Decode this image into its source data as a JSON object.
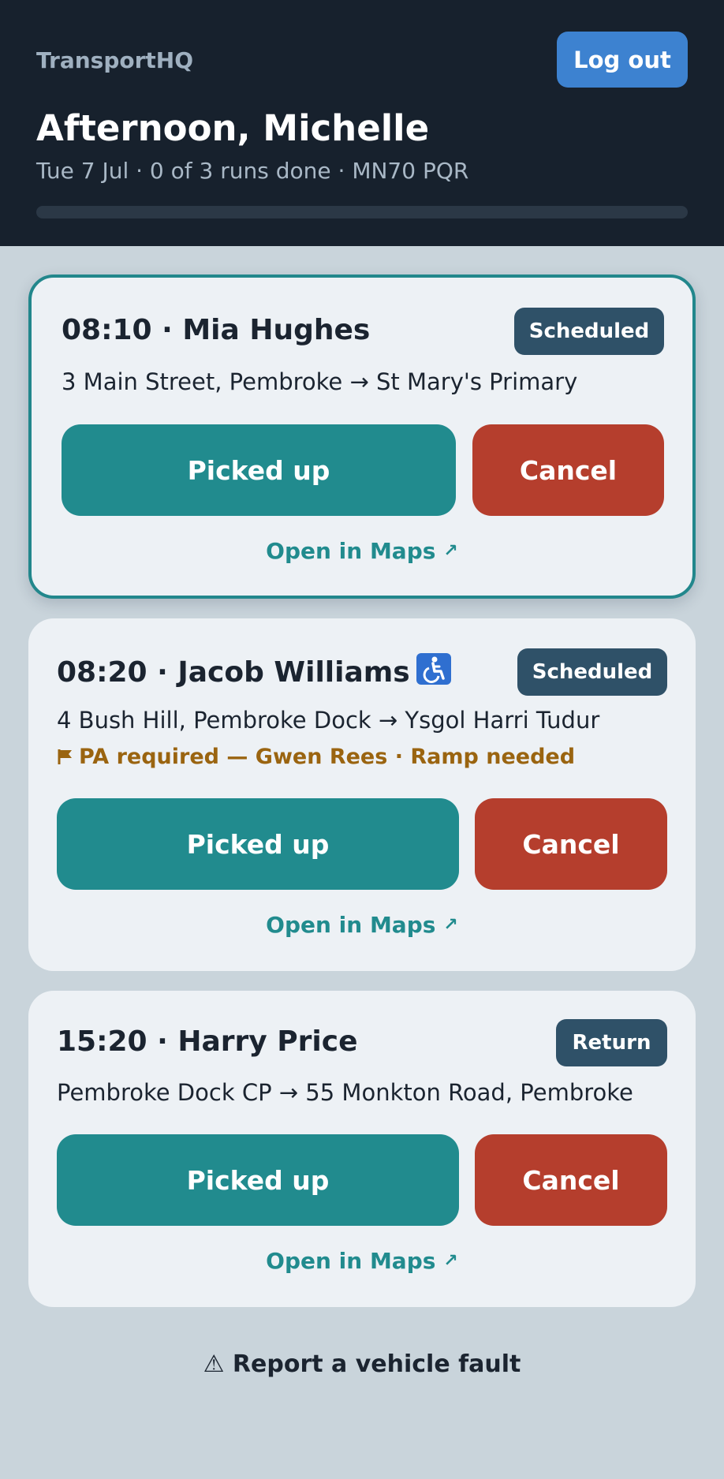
{
  "header": {
    "brand": "TransportHQ",
    "logout_label": "Log out",
    "greeting": "Afternoon, Michelle",
    "subline": "Tue 7 Jul · 0 of 3 runs done · MN70 PQR",
    "progress_done_fraction": 0
  },
  "runs": [
    {
      "title": "08:10 · Mia Hughes",
      "badge": "Scheduled",
      "route": "3 Main Street, Pembroke → St Mary's Primary",
      "picked_label": "Picked up",
      "cancel_label": "Cancel",
      "maps_label": "Open in Maps",
      "maps_icon": "↗"
    },
    {
      "title": "08:20 · Jacob Williams",
      "accessibility_icon": "wheelchair-icon",
      "badge": "Scheduled",
      "route": "4 Bush Hill, Pembroke Dock → Ysgol Harri Tudur",
      "note": "PA required — Gwen Rees · Ramp needed",
      "picked_label": "Picked up",
      "cancel_label": "Cancel",
      "maps_label": "Open in Maps",
      "maps_icon": "↗"
    },
    {
      "title": "15:20 · Harry Price",
      "badge": "Return",
      "route": "Pembroke Dock CP → 55 Monkton Road, Pembroke",
      "picked_label": "Picked up",
      "cancel_label": "Cancel",
      "maps_label": "Open in Maps",
      "maps_icon": "↗"
    }
  ],
  "footer": {
    "fault_label": "⚠ Report a vehicle fault"
  },
  "colors": {
    "header_bg": "#17212d",
    "accent_teal": "#218b8e",
    "cancel_red": "#b53e2d",
    "badge_bg": "#2f5168",
    "note_amber": "#9a6410",
    "logout_blue": "#3d82d0"
  }
}
